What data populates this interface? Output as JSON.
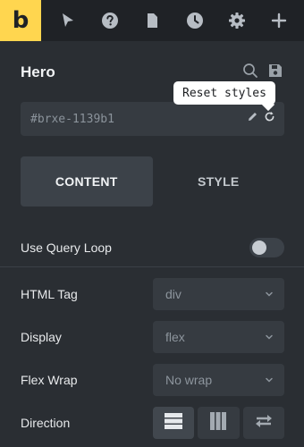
{
  "brand": {
    "logo_letter": "b",
    "accent_color": "#ffd64f"
  },
  "toolbar": {
    "icons": [
      "cursor-icon",
      "help-icon",
      "page-icon",
      "history-icon",
      "settings-icon",
      "add-icon"
    ]
  },
  "element": {
    "title": "Hero",
    "id_value": "#brxe-1139b1",
    "tooltip": "Reset styles"
  },
  "tabs": [
    {
      "label": "CONTENT",
      "active": true
    },
    {
      "label": "STYLE",
      "active": false
    }
  ],
  "query_loop": {
    "label": "Use Query Loop",
    "enabled": false
  },
  "controls": {
    "html_tag": {
      "label": "HTML Tag",
      "value": "div"
    },
    "display": {
      "label": "Display",
      "value": "flex"
    },
    "flex_wrap": {
      "label": "Flex Wrap",
      "value": "No wrap"
    },
    "direction": {
      "label": "Direction",
      "options": [
        "column-icon",
        "row-icon",
        "reverse-icon"
      ],
      "selected": "column-icon"
    }
  }
}
